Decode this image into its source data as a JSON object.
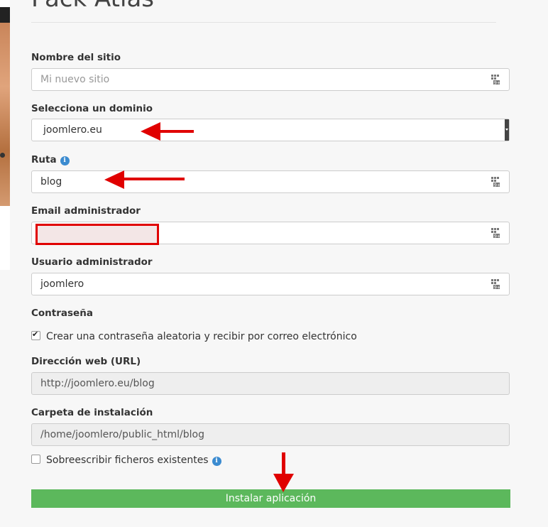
{
  "page": {
    "title": "Pack Atlas"
  },
  "form": {
    "site_name": {
      "label": "Nombre del sitio",
      "placeholder": "Mi nuevo sitio",
      "value": ""
    },
    "domain": {
      "label": "Selecciona un dominio",
      "value": "joomlero.eu"
    },
    "path": {
      "label": "Ruta",
      "value": "blog"
    },
    "admin_email": {
      "label": "Email administrador",
      "value": ""
    },
    "admin_user": {
      "label": "Usuario administrador",
      "value": "joomlero"
    },
    "password": {
      "label": "Contraseña",
      "random_option": "Crear una contraseña aleatoria y recibir por correo electrónico",
      "random_checked": true
    },
    "url": {
      "label": "Dirección web (URL)",
      "value": "http://joomlero.eu/blog"
    },
    "install_folder": {
      "label": "Carpeta de instalación",
      "value": "/home/joomlero/public_html/blog"
    },
    "overwrite": {
      "label": "Sobreescribir ficheros existentes",
      "checked": false
    },
    "install_button": "Instalar aplicación"
  },
  "icons": {
    "field_icon": "keyboard-icon",
    "info": "info-icon"
  },
  "colors": {
    "accent_button": "#5cb85c",
    "annotation": "#e00000",
    "info": "#3b8bd0"
  }
}
